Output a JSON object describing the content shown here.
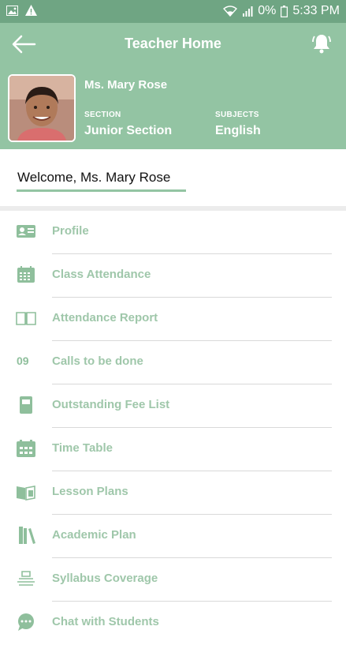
{
  "status": {
    "battery": "0%",
    "time": "5:33 PM"
  },
  "header": {
    "title": "Teacher Home"
  },
  "teacher": {
    "name": "Ms. Mary Rose",
    "section_label": "SECTION",
    "section_value": "Junior Section",
    "subjects_label": "SUBJECTS",
    "subjects_value": "English"
  },
  "welcome": "Welcome, Ms. Mary Rose",
  "menu": [
    {
      "label": "Profile",
      "icon": "id-card-icon"
    },
    {
      "label": "Class Attendance",
      "icon": "calendar-grid-icon"
    },
    {
      "label": "Attendance Report",
      "icon": "open-book-icon"
    },
    {
      "label": "Calls to be done",
      "icon": "count",
      "count": "09"
    },
    {
      "label": "Outstanding Fee List",
      "icon": "ledger-icon"
    },
    {
      "label": "Time Table",
      "icon": "timetable-icon"
    },
    {
      "label": "Lesson Plans",
      "icon": "lesson-book-icon"
    },
    {
      "label": "Academic Plan",
      "icon": "books-icon"
    },
    {
      "label": "Syllabus Coverage",
      "icon": "stack-icon"
    },
    {
      "label": "Chat with Students",
      "icon": "chat-bubble-icon"
    }
  ],
  "colors": {
    "statusbar": "#6fa583",
    "header": "#93c4a3",
    "menu_text": "#9fc7aa"
  }
}
